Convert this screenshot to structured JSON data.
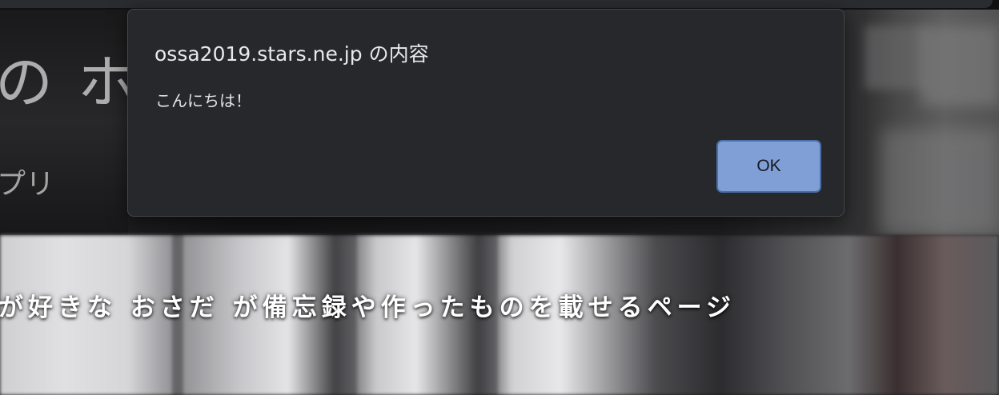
{
  "background_page": {
    "heading": "の ホ",
    "subtitle": "プリ",
    "tagline": "が好きな おさだ が備忘録や作ったものを載せるページ"
  },
  "alert_dialog": {
    "title": "ossa2019.stars.ne.jp の内容",
    "message": "こんにちは！",
    "ok_label": "OK"
  },
  "colors": {
    "dialog_background": "#27282c",
    "ok_button": "#7f9fd6",
    "ok_button_border": "#4b6fa8"
  }
}
